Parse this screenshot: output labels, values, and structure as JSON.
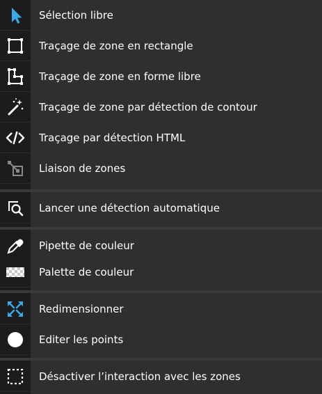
{
  "colors": {
    "background": "#2f2f2f",
    "icon_background": "#1c1c1c",
    "accent_blue": "#3aa9e8",
    "text": "#ffffff",
    "disabled_icon": "#8a8a8a"
  },
  "menu": {
    "items": [
      {
        "label": "Sélection libre",
        "icon": "cursor-arrow-icon"
      },
      {
        "label": "Traçage de zone en rectangle",
        "icon": "rectangle-icon"
      },
      {
        "label": "Traçage de zone en forme libre",
        "icon": "freeform-polygon-icon"
      },
      {
        "label": "Traçage de zone par détection de contour",
        "icon": "magic-wand-icon"
      },
      {
        "label": "Traçage par détection HTML",
        "icon": "code-tag-icon"
      },
      {
        "label": "Liaison de zones",
        "icon": "link-zones-icon"
      },
      {
        "label": "Lancer une détection automatique",
        "icon": "search-zone-icon"
      },
      {
        "label": "Pipette de couleur",
        "icon": "eyedropper-icon"
      },
      {
        "label": "Palette de couleur",
        "icon": "checkerboard-palette-icon"
      },
      {
        "label": "Redimensionner",
        "icon": "resize-arrows-icon"
      },
      {
        "label": "Editer les points",
        "icon": "circle-point-icon"
      },
      {
        "label": "Désactiver l’interaction avec les zones",
        "icon": "dashed-rectangle-icon"
      }
    ]
  }
}
